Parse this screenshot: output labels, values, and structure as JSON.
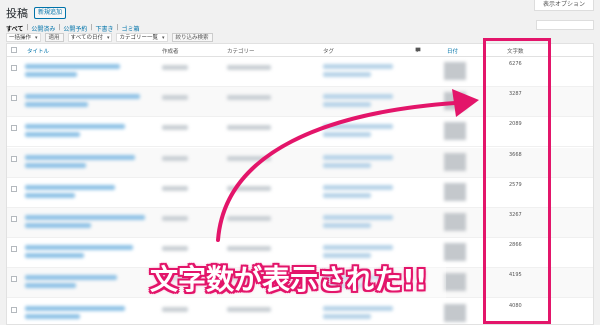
{
  "header": {
    "page_title": "投稿",
    "add_new_label": "新規追加",
    "screen_options_label": "表示オプション"
  },
  "views": {
    "all": "すべて",
    "published": "公開済み",
    "scheduled": "公開予約",
    "drafts": "下書き",
    "trash": "ゴミ箱"
  },
  "toolbar": {
    "bulk_action": "一括操作",
    "apply": "適用",
    "all_dates": "すべての日付",
    "category_select": "カテゴリー一覧",
    "filter": "絞り込み検索"
  },
  "table": {
    "columns": {
      "title": "タイトル",
      "author": "作成者",
      "categories": "カテゴリー",
      "tags": "タグ",
      "comments": "",
      "date": "日付",
      "word_count": "文字数"
    },
    "word_counts": [
      "6276",
      "3287",
      "2089",
      "3668",
      "2579",
      "3267",
      "2866",
      "4195",
      "4080"
    ]
  },
  "annotation": {
    "callout": "文字数が表示された!!",
    "accent_color": "#e3156a"
  },
  "icons": {
    "comments": "speech-bubble-icon",
    "dropdown": "chevron-down-icon"
  }
}
